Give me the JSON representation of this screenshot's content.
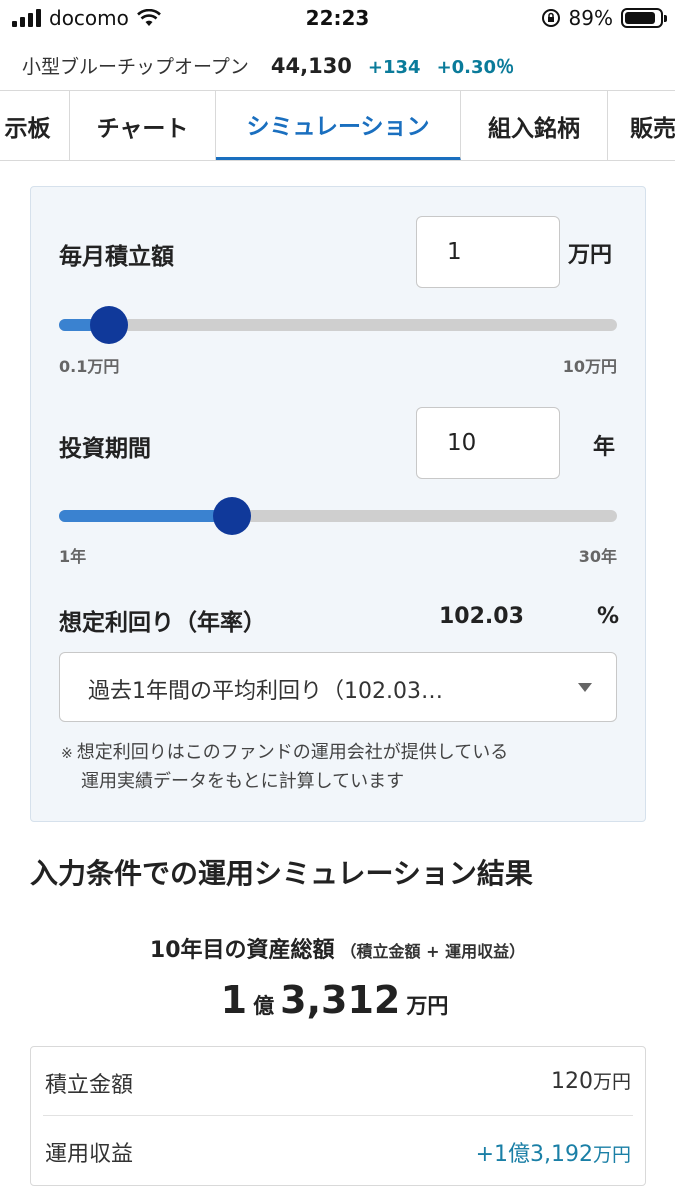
{
  "status": {
    "carrier": "docomo",
    "time": "22:23",
    "battery": "89%",
    "battery_level": 0.89
  },
  "fund": {
    "name": "小型ブルーチップオープン",
    "price": "44,130",
    "change": "+134",
    "change_pct": "+0.30％"
  },
  "tabs": [
    {
      "label": "示板"
    },
    {
      "label": "チャート"
    },
    {
      "label": "シミュレーション",
      "active": true
    },
    {
      "label": "組入銘柄"
    },
    {
      "label": "販売"
    }
  ],
  "monthly": {
    "label": "毎月積立額",
    "value": "1",
    "unit": "万円",
    "min_label": "0.1万円",
    "max_label": "10万円",
    "slider_fraction": 0.09
  },
  "period": {
    "label": "投資期間",
    "value": "10",
    "unit": "年",
    "min_label": "1年",
    "max_label": "30年",
    "slider_fraction": 0.31
  },
  "rate": {
    "label": "想定利回り（年率）",
    "value": "102.03",
    "unit": "%",
    "select_text": "過去1年間の平均利回り（102.03…"
  },
  "note": {
    "mark": "※",
    "line1": "想定利回りはこのファンドの運用会社が提供している",
    "line2": "運用実績データをもとに計算しています"
  },
  "result": {
    "heading": "入力条件での運用シミュレーション結果",
    "total_label": "10年目の資産総額",
    "total_sub": "（積立金額 + 運用収益）",
    "total_oku": "1",
    "oku_unit": "億",
    "total_man": "3,312",
    "man_unit": "万円",
    "rows": [
      {
        "label": "積立金額",
        "value": "120",
        "unit": "万円"
      },
      {
        "label": "運用収益",
        "value": "+1億3,192",
        "unit": "万円"
      }
    ]
  },
  "colors": {
    "accent": "#1a6fbf",
    "slider_fill": "#3a82d0",
    "thumb": "#10399a",
    "positive": "#1a7fa6",
    "panel_bg": "#f2f6fa"
  }
}
